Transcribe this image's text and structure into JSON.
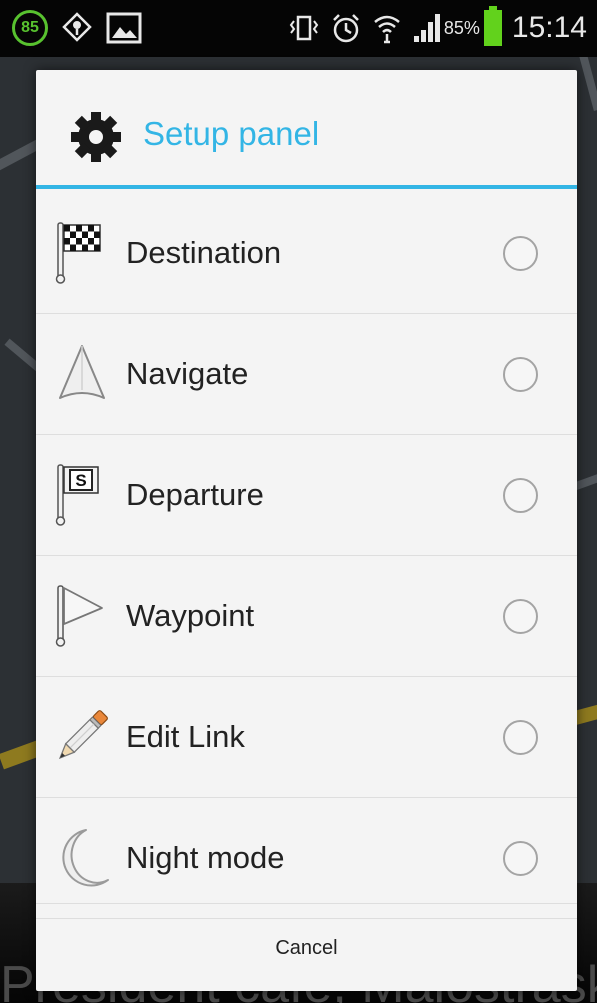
{
  "status_bar": {
    "notification_count": "85",
    "battery_percent": "85%",
    "time": "15:14",
    "icons": [
      "notification-count-icon",
      "location-icon",
      "image-icon",
      "vibrate-icon",
      "alarm-icon",
      "wifi-icon",
      "signal-icon",
      "battery-icon"
    ]
  },
  "map": {
    "caption": "President café, Malostraské"
  },
  "dialog": {
    "title": "Setup panel",
    "title_icon": "gear-icon",
    "accent_color": "#33b5e5",
    "items": [
      {
        "label": "Destination",
        "icon": "checkered-flag-icon",
        "selected": false
      },
      {
        "label": "Navigate",
        "icon": "navigation-arrow-icon",
        "selected": false
      },
      {
        "label": "Departure",
        "icon": "start-flag-icon",
        "selected": false
      },
      {
        "label": "Waypoint",
        "icon": "waypoint-flag-icon",
        "selected": false
      },
      {
        "label": "Edit Link",
        "icon": "pencil-icon",
        "selected": false
      },
      {
        "label": "Night mode",
        "icon": "moon-icon",
        "selected": false
      }
    ],
    "cancel_label": "Cancel"
  }
}
